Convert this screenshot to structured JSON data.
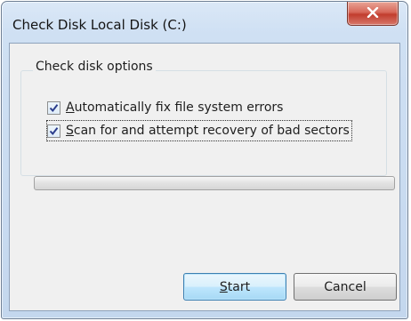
{
  "window": {
    "title": "Check Disk Local Disk (C:)",
    "close_icon": "close-icon"
  },
  "options_group": {
    "label": "Check disk options",
    "options": [
      {
        "accelerator": "A",
        "label_rest": "utomatically fix file system errors",
        "checked": true
      },
      {
        "accelerator": "S",
        "label_rest": "can for and attempt recovery of bad sectors",
        "checked": true
      }
    ]
  },
  "progress": {
    "value": 0
  },
  "buttons": {
    "start_accelerator": "S",
    "start_rest": "tart",
    "cancel_label": "Cancel"
  },
  "colors": {
    "close_button": "#c13d2e",
    "window_frame": "#c4d7ee",
    "default_button_border": "#3c7fb1"
  }
}
